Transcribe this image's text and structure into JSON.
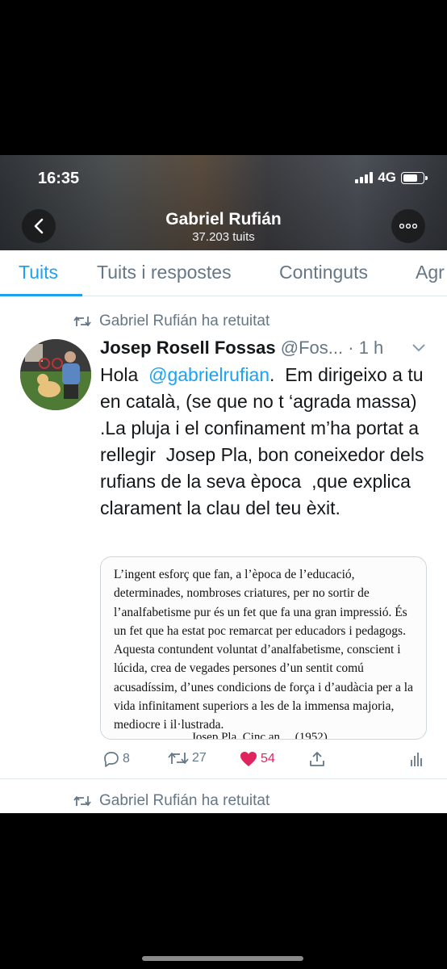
{
  "status_bar": {
    "time": "16:35",
    "network": "4G"
  },
  "profile": {
    "name": "Gabriel Rufián",
    "tweet_count": "37.203 tuits"
  },
  "tabs": [
    {
      "label": "Tuits",
      "active": true
    },
    {
      "label": "Tuits i respostes",
      "active": false
    },
    {
      "label": "Continguts",
      "active": false
    },
    {
      "label": "Agr",
      "active": false
    }
  ],
  "tweet": {
    "retweet_label": "Gabriel Rufián ha retuitat",
    "author_name": "Josep Rosell Fossas",
    "author_handle": "@Fos...",
    "time_ago": "· 1 h",
    "text_before": "Hola  ",
    "mention": "@gabrielrufian",
    "text_after": ".  Em dirigeixo a tu en català, (se que no t ‘agrada massa) .La pluja i el confinament m’ha portat a rellegir  Josep Pla, bon coneixedor dels rufians de la seva època  ,que explica clarament la clau del teu èxit.",
    "quote_text": "L’ingent esforç que fan, a l’època de l’educació, determinades, nombroses criatures, per no sortir de l’analfabetisme pur és un fet que fa una gran impressió. És un fet que ha estat poc remarcat per educadors i pedagogs. Aquesta contundent voluntat d’analfabetisme, conscient i lúcida, crea de vegades persones d’un sentit comú acusadíssim, d’unes condicions de força i d’audàcia per a la vida infinitament superiors a les de la immensa majoria, mediocre i il·lustrada.",
    "quote_cutoff": "Josep Pla, Cinc an… (1952)",
    "replies": "8",
    "retweets": "27",
    "likes": "54"
  },
  "next_tweet": {
    "retweet_label": "Gabriel Rufián ha retuitat"
  },
  "colors": {
    "accent": "#1da1f2",
    "like": "#e0245e",
    "muted": "#657786"
  }
}
